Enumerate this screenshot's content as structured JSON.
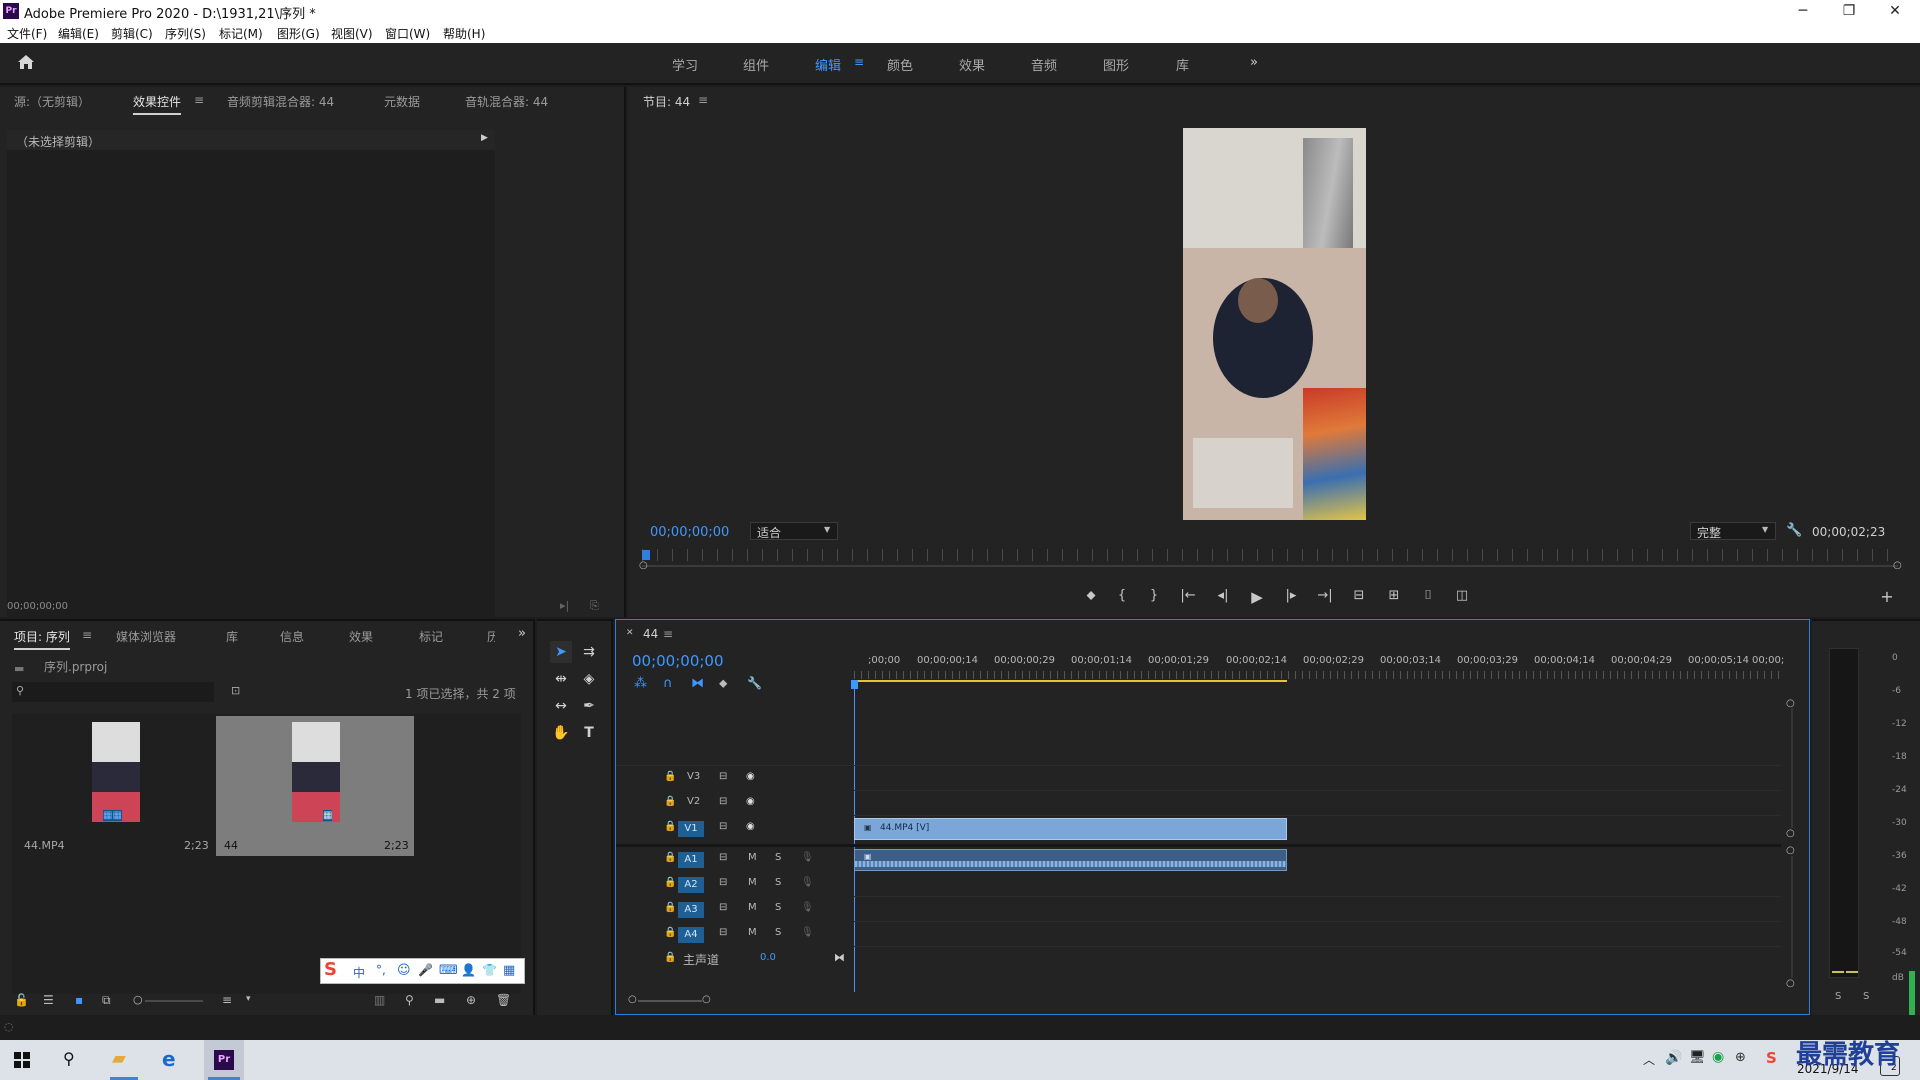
{
  "window": {
    "title": "Adobe Premiere Pro 2020 - D:\\1931,21\\序列 *",
    "app_icon": "Pr",
    "minimize": "─",
    "restore": "❐",
    "close": "✕"
  },
  "menu": [
    "文件(F)",
    "编辑(E)",
    "剪辑(C)",
    "序列(S)",
    "标记(M)",
    "图形(G)",
    "视图(V)",
    "窗口(W)",
    "帮助(H)"
  ],
  "workspaces": {
    "items": [
      "学习",
      "组件",
      "编辑",
      "颜色",
      "效果",
      "音频",
      "图形",
      "库"
    ],
    "active": "编辑",
    "more": "»"
  },
  "source_panel": {
    "tabs": [
      "源:（无剪辑）",
      "效果控件",
      "音频剪辑混合器: 44",
      "元数据",
      "音轨混合器: 44"
    ],
    "active_tab": "效果控件",
    "no_clip": "（未选择剪辑）",
    "timecode": "00;00;00;00"
  },
  "program": {
    "title": "节目: 44",
    "timecode": "00;00;00;00",
    "fit": "适合",
    "quality": "完整",
    "duration": "00;00;02;23",
    "playhead_fraction": 0.0
  },
  "project": {
    "tabs": [
      "项目: 序列",
      "媒体浏览器",
      "库",
      "信息",
      "效果",
      "标记",
      "历"
    ],
    "file": "序列.prproj",
    "selection": "1 项已选择，共 2 项",
    "items": [
      {
        "name": "44.MP4",
        "duration": "2;23",
        "selected": false
      },
      {
        "name": "44",
        "duration": "2;23",
        "selected": true
      }
    ]
  },
  "ime_bar": [
    "S",
    "中",
    "°,",
    "☺",
    "🎤",
    "⌨",
    "👤",
    "👕",
    "▦"
  ],
  "timeline": {
    "seq_name": "44",
    "timecode": "00;00;00;00",
    "ruler": [
      ";00;00",
      "00;00;00;14",
      "00;00;00;29",
      "00;00;01;14",
      "00;00;01;29",
      "00;00;02;14",
      "00;00;02;29",
      "00;00;03;14",
      "00;00;03;29",
      "00;00;04;14",
      "00;00;04;29",
      "00;00;05;14",
      "00;00;0"
    ],
    "video_tracks": [
      "V3",
      "V2",
      "V1"
    ],
    "audio_tracks": [
      "A1",
      "A2",
      "A3",
      "A4"
    ],
    "master": "主声道",
    "master_value": "0.0",
    "clip_v": "44.MP4 [V]",
    "m": "M",
    "s": "S"
  },
  "meter": {
    "labels": [
      "0",
      "-6",
      "-12",
      "-18",
      "-24",
      "-30",
      "-36",
      "-42",
      "-48",
      "-54",
      "dB"
    ],
    "solo": [
      "S",
      "S"
    ]
  },
  "watermark": "最需教育",
  "taskbar": {
    "date": "2021/9/14",
    "notify": "2"
  }
}
